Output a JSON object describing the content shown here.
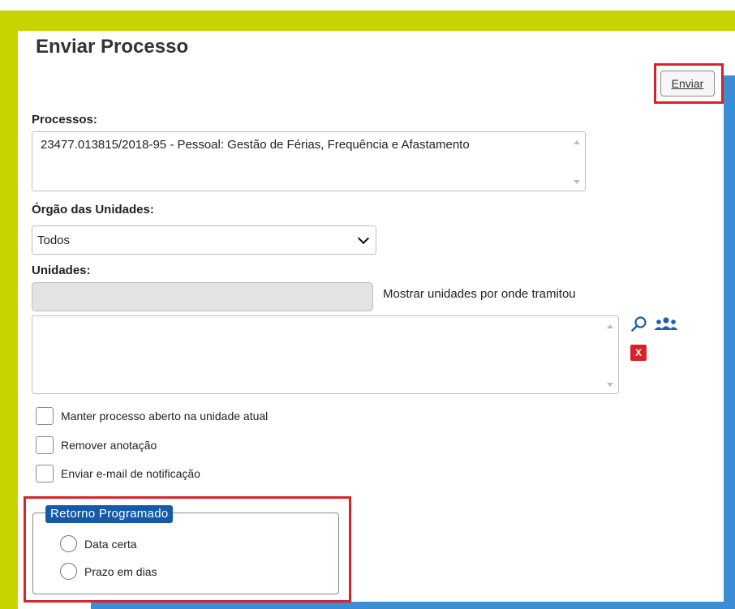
{
  "page": {
    "title": "Enviar Processo"
  },
  "toolbar": {
    "send_label": "Enviar"
  },
  "processos": {
    "label": "Processos:",
    "value": "23477.013815/2018-95 - Pessoal: Gestão de Férias, Frequência e Afastamento"
  },
  "orgao": {
    "label": "Órgão das Unidades:",
    "selected": "Todos"
  },
  "unidades": {
    "label": "Unidades:",
    "input_value": "",
    "show_link": "Mostrar unidades por onde tramitou"
  },
  "icons": {
    "search": "search-icon",
    "group": "users-group-icon",
    "remove": "remove-x-icon",
    "remove_glyph": "X"
  },
  "options": [
    {
      "label": "Manter processo aberto na unidade atual",
      "checked": false
    },
    {
      "label": "Remover anotação",
      "checked": false
    },
    {
      "label": "Enviar e-mail de notificação",
      "checked": false
    }
  ],
  "retorno": {
    "legend": "Retorno Programado",
    "choices": [
      {
        "label": "Data certa",
        "selected": false
      },
      {
        "label": "Prazo em dias",
        "selected": false
      }
    ]
  },
  "colors": {
    "frame_yellow": "#c8d400",
    "frame_blue": "#3b8ed4",
    "highlight_red": "#d9232a",
    "legend_blue": "#155aa8",
    "icon_blue": "#1f5fa8"
  }
}
